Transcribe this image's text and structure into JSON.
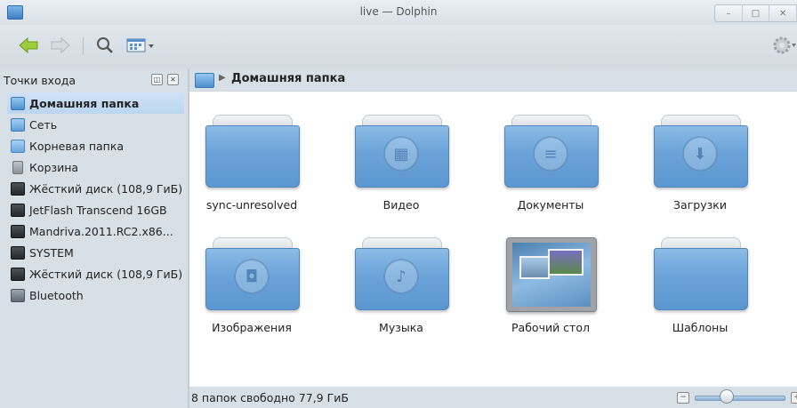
{
  "window": {
    "title": "live — Dolphin",
    "controls": {
      "minimize": "–",
      "maximize": "□",
      "close": "✕"
    }
  },
  "toolbar": {
    "back_icon": "arrow-left-icon",
    "forward_icon": "arrow-right-icon",
    "search_icon": "search-icon",
    "view_mode_icon": "view-mode-icon",
    "settings_icon": "gear-icon"
  },
  "sidebar": {
    "header": "Точки входа",
    "items": [
      {
        "label": "Домашняя папка",
        "icon": "home-folder-icon",
        "selected": true
      },
      {
        "label": "Сеть",
        "icon": "network-icon"
      },
      {
        "label": "Корневая папка",
        "icon": "root-folder-icon"
      },
      {
        "label": "Корзина",
        "icon": "trash-icon"
      },
      {
        "label": "Жёсткий диск (108,9 ГиБ)",
        "icon": "hard-disk-icon"
      },
      {
        "label": "JetFlash Transcend 16GB",
        "icon": "usb-drive-icon"
      },
      {
        "label": "Mandriva.2011.RC2.x86...",
        "icon": "hard-disk-icon"
      },
      {
        "label": "SYSTEM",
        "icon": "usb-drive-icon"
      },
      {
        "label": "Жёсткий диск (108,9 ГиБ)",
        "icon": "hard-disk-icon"
      },
      {
        "label": "Bluetooth",
        "icon": "bluetooth-icon"
      }
    ]
  },
  "breadcrumb": {
    "current": "Домашняя папка"
  },
  "files": [
    {
      "name": "sync-unresolved",
      "icon": "folder-icon"
    },
    {
      "name": "Видео",
      "icon": "folder-video-icon"
    },
    {
      "name": "Документы",
      "icon": "folder-documents-icon"
    },
    {
      "name": "Загрузки",
      "icon": "folder-downloads-icon"
    },
    {
      "name": "Изображения",
      "icon": "folder-pictures-icon"
    },
    {
      "name": "Музыка",
      "icon": "folder-music-icon"
    },
    {
      "name": "Рабочий стол",
      "icon": "desktop-folder-icon"
    },
    {
      "name": "Шаблоны",
      "icon": "folder-icon"
    }
  ],
  "status": {
    "text": "8 папок  свободно 77,9 ГиБ",
    "zoom_level": 0.3
  },
  "colors": {
    "folder": "#6aa3d8",
    "selection": "#bcd6f0",
    "panel": "#d8e0e7"
  }
}
